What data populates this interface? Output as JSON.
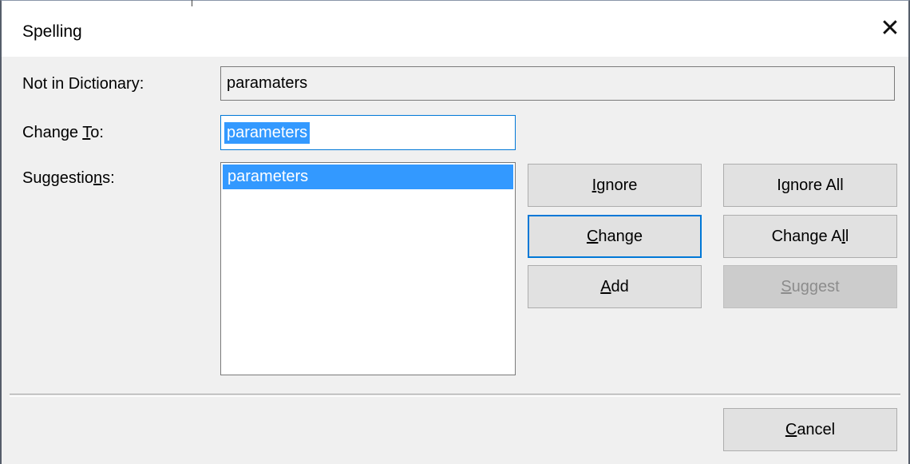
{
  "dialog": {
    "title": "Spelling",
    "close_glyph": "✕"
  },
  "labels": {
    "not_in_dictionary": "Not in Dictionary:",
    "change_to_pre": "Change ",
    "change_to_u": "T",
    "change_to_post": "o:",
    "suggestions_pre": "Suggestio",
    "suggestions_u": "n",
    "suggestions_post": "s:"
  },
  "fields": {
    "not_in_dictionary_value": "paramaters",
    "change_to_value": "parameters"
  },
  "suggestions": {
    "items": [
      "parameters"
    ],
    "selected_index": 0
  },
  "buttons": {
    "ignore": {
      "pre": "",
      "u": "I",
      "post": "gnore"
    },
    "ignore_all": {
      "pre": "I",
      "u": "g",
      "post": "nore All"
    },
    "change": {
      "pre": "",
      "u": "C",
      "post": "hange"
    },
    "change_all": {
      "pre": "Change A",
      "u": "l",
      "post": "l"
    },
    "add": {
      "pre": "",
      "u": "A",
      "post": "dd"
    },
    "suggest": {
      "pre": "",
      "u": "S",
      "post": "uggest",
      "disabled": true
    },
    "cancel": {
      "pre": "",
      "u": "C",
      "post": "ancel"
    }
  },
  "colors": {
    "accent": "#0078d7",
    "selection": "#3399ff",
    "dialog_bg": "#f0f0f0"
  }
}
